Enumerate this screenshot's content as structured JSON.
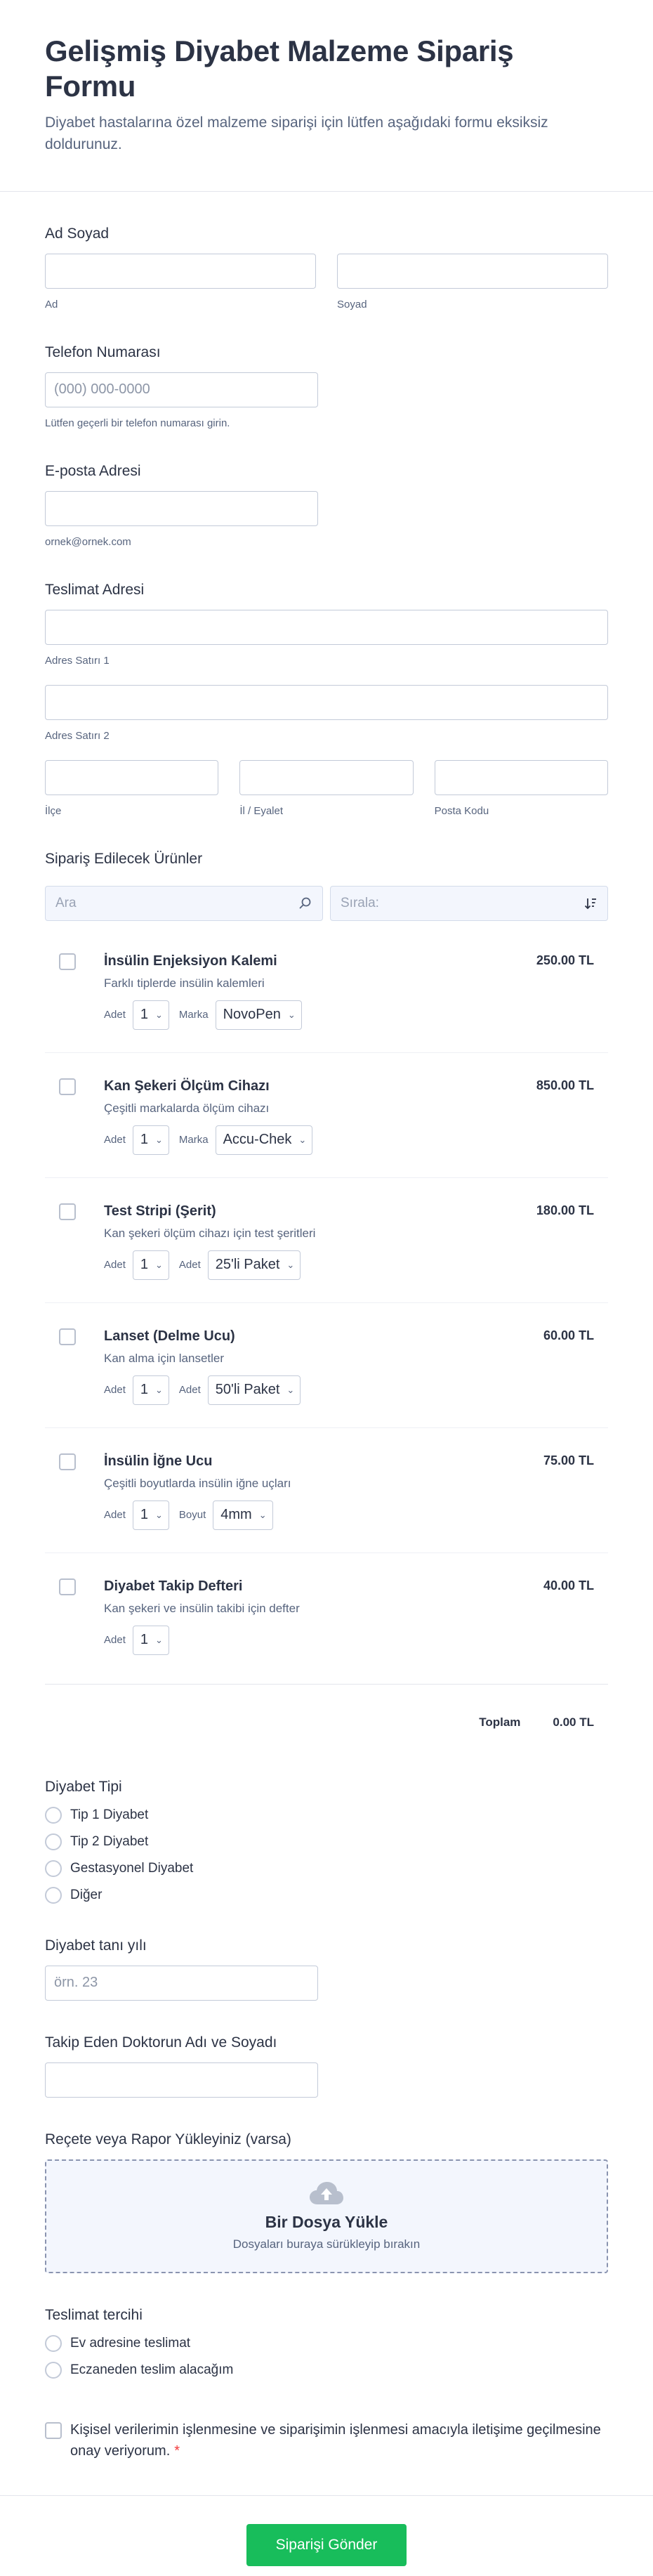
{
  "header": {
    "title": "Gelişmiş Diyabet Malzeme Sipariş Formu",
    "description": "Diyabet hastalarına özel malzeme siparişi için lütfen aşağıdaki formu eksiksiz doldurunuz."
  },
  "name": {
    "label": "Ad Soyad",
    "first_sublabel": "Ad",
    "last_sublabel": "Soyad"
  },
  "phone": {
    "label": "Telefon Numarası",
    "placeholder": "(000) 000-0000",
    "sublabel": "Lütfen geçerli bir telefon numarası girin."
  },
  "email": {
    "label": "E-posta Adresi",
    "sublabel": "ornek@ornek.com"
  },
  "address": {
    "label": "Teslimat Adresi",
    "line1": "Adres Satırı 1",
    "line2": "Adres Satırı 2",
    "district": "İlçe",
    "province": "İl / Eyalet",
    "postal": "Posta Kodu"
  },
  "products": {
    "label": "Sipariş Edilecek Ürünler",
    "search_placeholder": "Ara",
    "sort_placeholder": "Sırala:",
    "currency": "TL",
    "items": [
      {
        "name": "İnsülin Enjeksiyon Kalemi",
        "desc": "Farklı tiplerde insülin kalemleri",
        "price": "250.00",
        "qty_label": "Adet",
        "qty": "1",
        "opt_label": "Marka",
        "opt_value": "NovoPen"
      },
      {
        "name": "Kan Şekeri Ölçüm Cihazı",
        "desc": "Çeşitli markalarda ölçüm cihazı",
        "price": "850.00",
        "qty_label": "Adet",
        "qty": "1",
        "opt_label": "Marka",
        "opt_value": "Accu-Chek"
      },
      {
        "name": "Test Stripi (Şerit)",
        "desc": "Kan şekeri ölçüm cihazı için test şeritleri",
        "price": "180.00",
        "qty_label": "Adet",
        "qty": "1",
        "opt_label": "Adet",
        "opt_value": "25'li Paket"
      },
      {
        "name": "Lanset (Delme Ucu)",
        "desc": "Kan alma için lansetler",
        "price": "60.00",
        "qty_label": "Adet",
        "qty": "1",
        "opt_label": "Adet",
        "opt_value": "50'li Paket"
      },
      {
        "name": "İnsülin İğne Ucu",
        "desc": "Çeşitli boyutlarda insülin iğne uçları",
        "price": "75.00",
        "qty_label": "Adet",
        "qty": "1",
        "opt_label": "Boyut",
        "opt_value": "4mm"
      },
      {
        "name": "Diyabet Takip Defteri",
        "desc": "Kan şekeri ve insülin takibi için defter",
        "price": "40.00",
        "qty_label": "Adet",
        "qty": "1",
        "opt_label": "",
        "opt_value": ""
      }
    ],
    "total_label": "Toplam",
    "total_value": "0.00"
  },
  "diabetes_type": {
    "label": "Diyabet Tipi",
    "options": [
      "Tip 1 Diyabet",
      "Tip 2 Diyabet",
      "Gestasyonel Diyabet",
      "Diğer"
    ]
  },
  "diagnosis_year": {
    "label": "Diyabet tanı yılı",
    "placeholder": "örn. 23"
  },
  "doctor": {
    "label": "Takip Eden Doktorun Adı ve Soyadı"
  },
  "upload": {
    "label": "Reçete veya Rapor Yükleyiniz (varsa)",
    "title": "Bir Dosya Yükle",
    "subtitle": "Dosyaları buraya sürükleyip bırakın"
  },
  "delivery": {
    "label": "Teslimat tercihi",
    "options": [
      "Ev adresine teslimat",
      "Eczaneden teslim alacağım"
    ]
  },
  "consent": {
    "text": "Kişisel verilerimin işlenmesine ve siparişimin işlenmesi amacıyla iletişime geçilmesine onay veriyorum.",
    "required_mark": "*"
  },
  "submit": {
    "label": "Siparişi Gönder"
  },
  "colors": {
    "accent": "#18bd5b",
    "text": "#2c3345",
    "muted": "#57647e",
    "required": "#f23a3c"
  }
}
